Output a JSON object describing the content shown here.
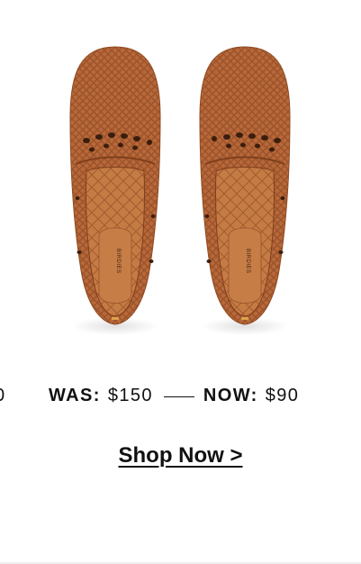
{
  "product": {
    "image_alt": "Woven loafers, top view",
    "insole_brand": "BIRDIES",
    "edge_text": "0"
  },
  "pricing": {
    "was_label": "WAS:",
    "was_value": "$150",
    "now_label": "NOW:",
    "now_value": "$90"
  },
  "cta": {
    "shop_now_label": "Shop Now >"
  },
  "colors": {
    "leather": "#B8683A",
    "leather_dark": "#8F4A22",
    "insole": "#C2773F",
    "text": "#111111"
  }
}
